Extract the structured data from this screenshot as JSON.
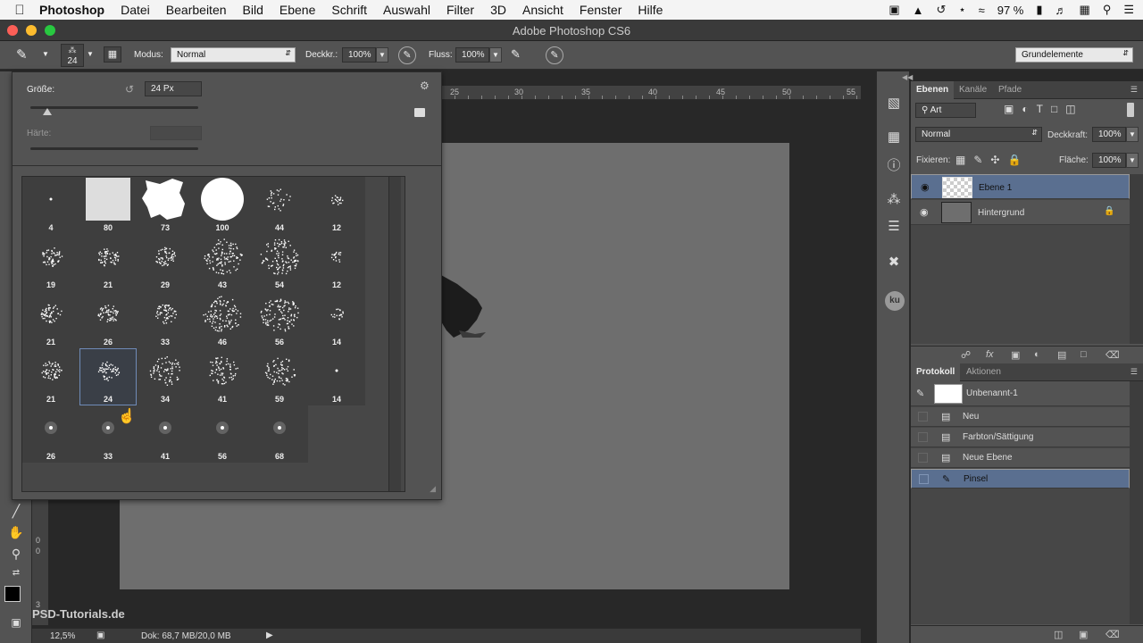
{
  "menubar": {
    "app": "Photoshop",
    "items": [
      "Datei",
      "Bearbeiten",
      "Bild",
      "Ebene",
      "Schrift",
      "Auswahl",
      "Filter",
      "3D",
      "Ansicht",
      "Fenster",
      "Hilfe"
    ],
    "battery": "97 %"
  },
  "window": {
    "title": "Adobe Photoshop CS6"
  },
  "options": {
    "brush_size": "24",
    "mode_label": "Modus:",
    "mode_value": "Normal",
    "opacity_label": "Deckkr.:",
    "opacity_value": "100%",
    "flow_label": "Fluss:",
    "flow_value": "100%",
    "workspace": "Grundelemente"
  },
  "popup": {
    "size_label": "Größe:",
    "size_value": "24 Px",
    "size_slider": 0.1,
    "hardness_label": "Härte:",
    "brushes": [
      {
        "size": "4",
        "kind": "dot"
      },
      {
        "size": "80",
        "kind": "texture"
      },
      {
        "size": "73",
        "kind": "splat"
      },
      {
        "size": "100",
        "kind": "round"
      },
      {
        "size": "44",
        "kind": "scatter"
      },
      {
        "size": "12",
        "kind": "scatter-small"
      },
      {
        "size": "19",
        "kind": "spray"
      },
      {
        "size": "21",
        "kind": "spray"
      },
      {
        "size": "29",
        "kind": "spray"
      },
      {
        "size": "43",
        "kind": "spray-big"
      },
      {
        "size": "54",
        "kind": "spray-big"
      },
      {
        "size": "12",
        "kind": "spray-small"
      },
      {
        "size": "21",
        "kind": "spray"
      },
      {
        "size": "26",
        "kind": "spray"
      },
      {
        "size": "33",
        "kind": "spray"
      },
      {
        "size": "46",
        "kind": "spray-big"
      },
      {
        "size": "56",
        "kind": "spray-big"
      },
      {
        "size": "14",
        "kind": "spray-small"
      },
      {
        "size": "21",
        "kind": "spray"
      },
      {
        "size": "24",
        "kind": "spray"
      },
      {
        "size": "34",
        "kind": "chalk"
      },
      {
        "size": "41",
        "kind": "chalk"
      },
      {
        "size": "59",
        "kind": "chalk"
      },
      {
        "size": "14",
        "kind": "dot"
      },
      {
        "size": "26",
        "kind": "star"
      },
      {
        "size": "33",
        "kind": "star"
      },
      {
        "size": "41",
        "kind": "star"
      },
      {
        "size": "56",
        "kind": "star"
      },
      {
        "size": "68",
        "kind": "star"
      }
    ],
    "selected_index": 19
  },
  "ruler_top": [
    "25",
    "30",
    "35",
    "40",
    "45",
    "50",
    "55"
  ],
  "ruler_left": [
    "0",
    "0",
    "3"
  ],
  "layers_panel": {
    "tabs": [
      "Ebenen",
      "Kanäle",
      "Pfade"
    ],
    "filter_kind": "Art",
    "blend_mode": "Normal",
    "opacity_label": "Deckkraft:",
    "opacity_value": "100%",
    "lock_label": "Fixieren:",
    "fill_label": "Fläche:",
    "fill_value": "100%",
    "layers": [
      {
        "name": "Ebene 1"
      },
      {
        "name": "Hintergrund"
      }
    ]
  },
  "history_panel": {
    "tabs": [
      "Protokoll",
      "Aktionen"
    ],
    "snapshot": "Unbenannt-1",
    "steps": [
      "Neu",
      "Farbton/Sättigung",
      "Neue Ebene",
      "Pinsel"
    ]
  },
  "status": {
    "zoom": "12,5%",
    "doc": "Dok: 68,7 MB/20,0 MB"
  },
  "watermark": "PSD-Tutorials.de",
  "colors": {
    "selection": "#5a6f90",
    "panel": "#535353",
    "doc": "#6e6e6e"
  }
}
